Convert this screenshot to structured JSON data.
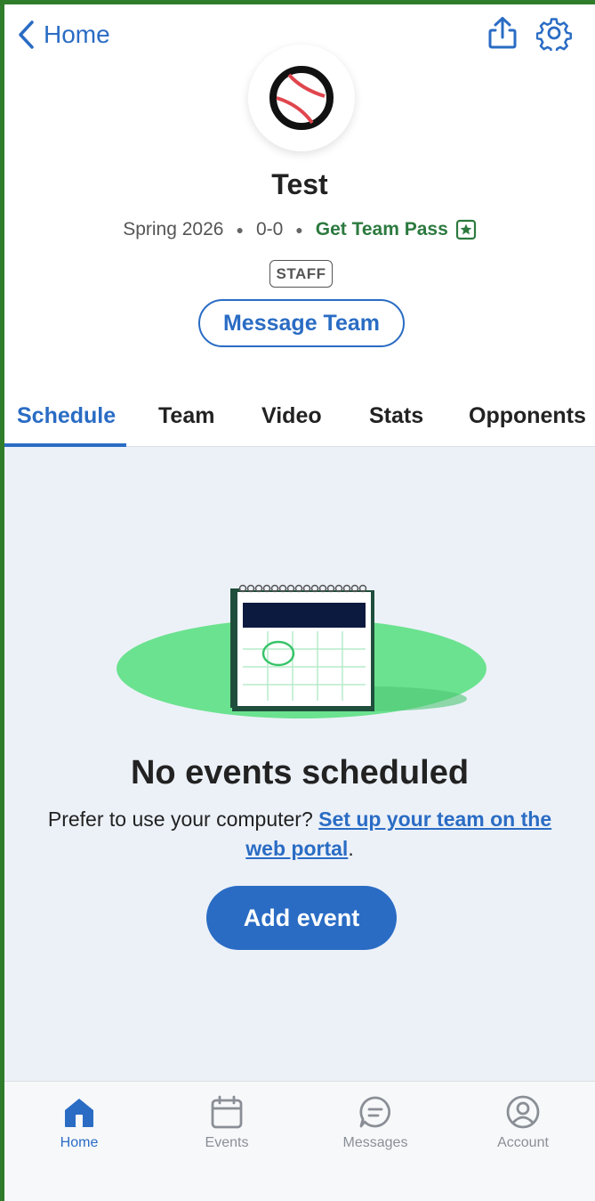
{
  "nav": {
    "back_label": "Home"
  },
  "header_icons": {
    "share": "share-icon",
    "settings": "gear-icon"
  },
  "team": {
    "logo": "baseball-icon",
    "name": "Test",
    "season": "Spring 2026",
    "record": "0-0",
    "team_pass_label": "Get Team Pass",
    "role_badge": "STAFF",
    "message_button": "Message Team"
  },
  "tabs": [
    {
      "label": "Schedule",
      "active": true
    },
    {
      "label": "Team"
    },
    {
      "label": "Video"
    },
    {
      "label": "Stats"
    },
    {
      "label": "Opponents"
    }
  ],
  "empty_state": {
    "illustration": "calendar-illustration",
    "title": "No events scheduled",
    "description_prefix": "Prefer to use your computer?",
    "link_text": "Set up your team on the web portal",
    "description_suffix": ".",
    "button_label": "Add event"
  },
  "bottom_nav": [
    {
      "label": "Home",
      "icon": "home-icon",
      "active": true
    },
    {
      "label": "Events",
      "icon": "calendar-icon"
    },
    {
      "label": "Messages",
      "icon": "message-icon"
    },
    {
      "label": "Account",
      "icon": "account-icon"
    }
  ],
  "colors": {
    "accent": "#2a6cc4",
    "pass_green": "#2c7a3f",
    "content_bg": "#ecf1f8",
    "frame_green": "#2f7d2a"
  }
}
